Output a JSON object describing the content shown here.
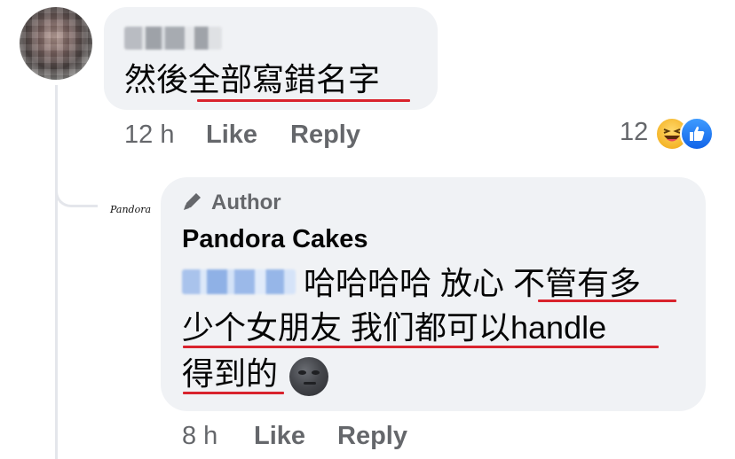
{
  "comment1": {
    "author_name": "",
    "text": "然後全部寫錯名字",
    "timestamp": "12 h",
    "like_label": "Like",
    "reply_label": "Reply",
    "reaction_count": "12",
    "reaction_icons": [
      "haha-icon",
      "like-icon"
    ]
  },
  "reply": {
    "avatar_label": "Pandora",
    "badge_icon": "pencil-icon",
    "badge_label": "Author",
    "author_name": "Pandora Cakes",
    "text_line1": "哈哈哈哈 放心 不管有多",
    "text_line2": "少个女朋友 我们都可以handle",
    "text_line3": "得到的",
    "emoji": "new-moon-face-emoji",
    "timestamp": "8 h",
    "like_label": "Like",
    "reply_label": "Reply"
  },
  "colors": {
    "bubble": "#f0f2f5",
    "secondary_text": "#65676b",
    "underline_annotation": "#d9232d",
    "thread_line": "#e4e6eb"
  }
}
